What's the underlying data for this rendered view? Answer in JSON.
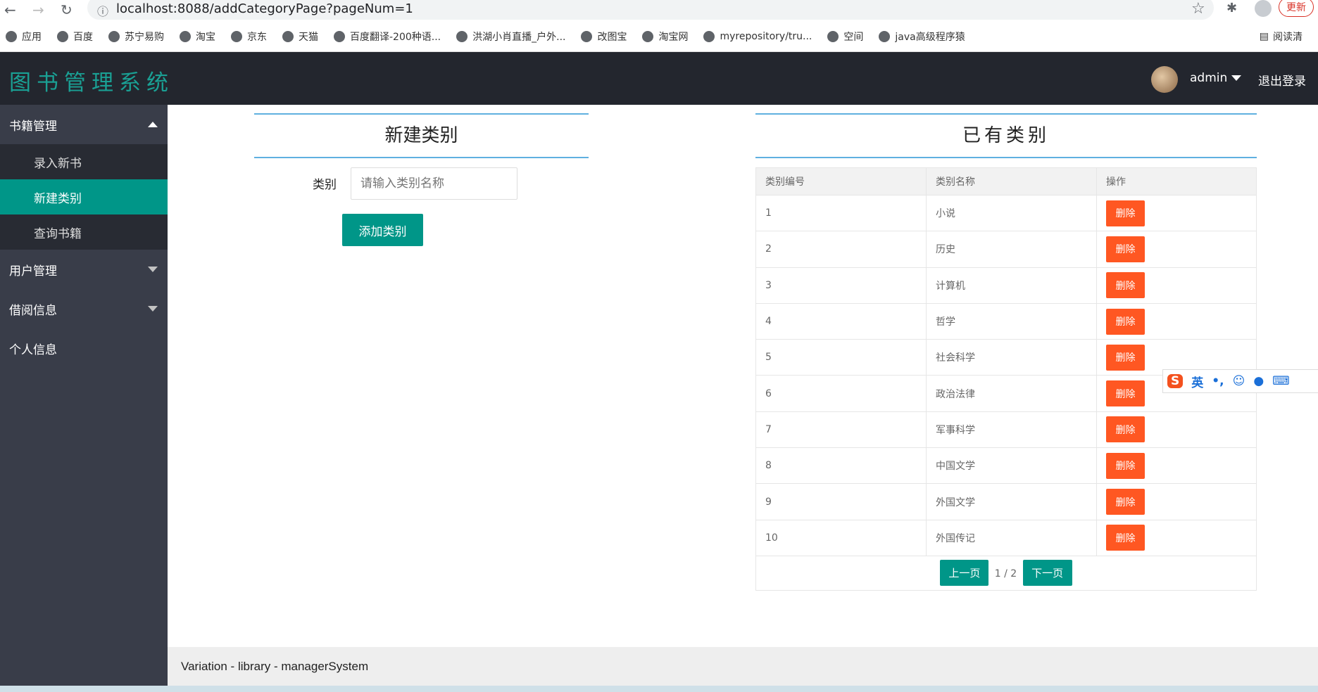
{
  "browser": {
    "url": "localhost:8088/addCategoryPage?pageNum=1",
    "update_label": "更新",
    "bookmarks": [
      "应用",
      "百度",
      "苏宁易购",
      "淘宝",
      "京东",
      "天猫",
      "百度翻译-200种语...",
      "洪湖小肖直播_户外...",
      "改图宝",
      "淘宝网",
      "myrepository/tru...",
      "空间",
      "java高级程序猿"
    ],
    "reading_list": "阅读清"
  },
  "header": {
    "logo": "图书管理系统",
    "user": "admin",
    "logout": "退出登录"
  },
  "sidebar": {
    "groups": [
      {
        "label": "书籍管理",
        "items": [
          "录入新书",
          "新建类别",
          "查询书籍"
        ]
      },
      {
        "label": "用户管理"
      },
      {
        "label": "借阅信息"
      },
      {
        "label": "个人信息"
      }
    ]
  },
  "form": {
    "title": "新建类别",
    "label": "类别",
    "placeholder": "请输入类别名称",
    "submit": "添加类别"
  },
  "list": {
    "title": "已有类别",
    "columns": [
      "类别编号",
      "类别名称",
      "操作"
    ],
    "delete_label": "删除",
    "rows": [
      [
        "1",
        "小说"
      ],
      [
        "2",
        "历史"
      ],
      [
        "3",
        "计算机"
      ],
      [
        "4",
        "哲学"
      ],
      [
        "5",
        "社会科学"
      ],
      [
        "6",
        "政治法律"
      ],
      [
        "7",
        "军事科学"
      ],
      [
        "8",
        "中国文学"
      ],
      [
        "9",
        "外国文学"
      ],
      [
        "10",
        "外国传记"
      ]
    ],
    "prev": "上一页",
    "page": "1 / 2",
    "next": "下一页"
  },
  "footer": "Variation - library - managerSystem",
  "ime": {
    "mode": "英"
  }
}
